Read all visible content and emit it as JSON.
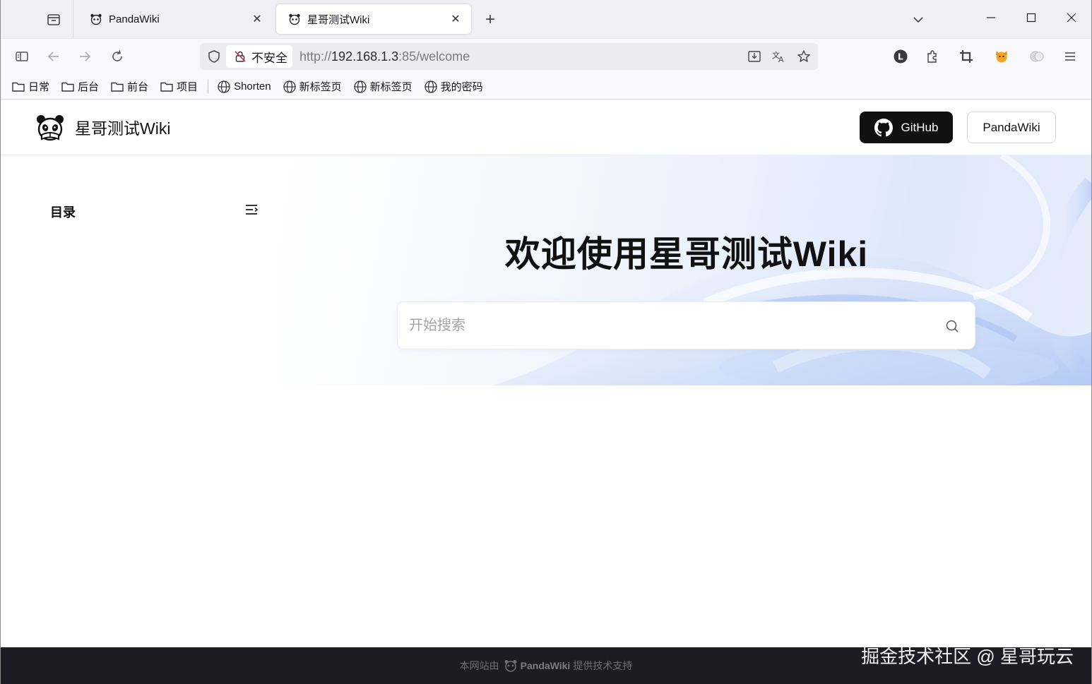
{
  "browser": {
    "tabs": [
      {
        "title": "PandaWiki",
        "active": false
      },
      {
        "title": "星哥测试Wiki",
        "active": true
      }
    ],
    "url": {
      "security_label": "不安全",
      "scheme": "http://",
      "host": "192.168.1.3",
      "rest": ":85/welcome"
    },
    "bookmarks": [
      {
        "label": "日常",
        "icon": "folder-icon"
      },
      {
        "label": "后台",
        "icon": "folder-icon"
      },
      {
        "label": "前台",
        "icon": "folder-icon"
      },
      {
        "label": "项目",
        "icon": "folder-icon"
      },
      {
        "label": "Shorten",
        "icon": "globe-icon"
      },
      {
        "label": "新标签页",
        "icon": "globe-icon"
      },
      {
        "label": "新标签页",
        "icon": "globe-icon"
      },
      {
        "label": "我的密码",
        "icon": "globe-icon"
      }
    ],
    "extension_badge": "L"
  },
  "site": {
    "name": "星哥测试Wiki",
    "github_label": "GitHub",
    "panda_label": "PandaWiki"
  },
  "sidebar": {
    "title": "目录"
  },
  "hero": {
    "title": "欢迎使用星哥测试Wiki",
    "search_placeholder": "开始搜索"
  },
  "footer": {
    "prefix": "本网站由",
    "brand": "PandaWiki",
    "suffix": "提供技术支持"
  },
  "watermark": "掘金技术社区 @ 星哥玩云",
  "colors": {
    "github_button": "#111111",
    "footer_bg": "#1c1c22",
    "hero_gradient_end": "#dfe8fb"
  }
}
